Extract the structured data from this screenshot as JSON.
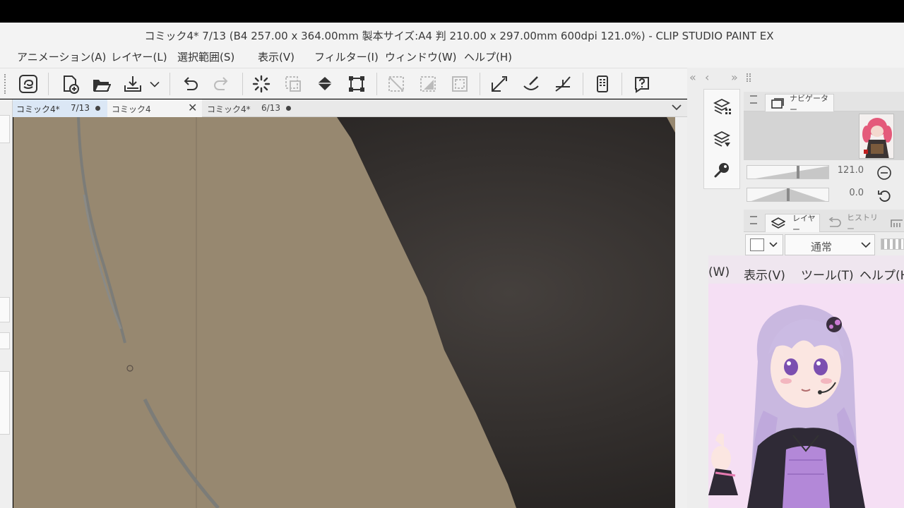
{
  "window": {
    "title": "コミック4* 7/13 (B4 257.00 x 364.00mm 製本サイズ:A4 判 210.00 x 297.00mm 600dpi 121.0%)  - CLIP STUDIO PAINT EX"
  },
  "menu": {
    "items": [
      "アニメーション(A)",
      "レイヤー(L)",
      "選択範囲(S)",
      "表示(V)",
      "フィルター(I)",
      "ウィンドウ(W)",
      "ヘルプ(H)"
    ]
  },
  "toolbar": {
    "buttons": [
      "clip-studio-icon",
      "new-file-icon",
      "open-folder-icon",
      "save-icon",
      "save-dropdown-icon",
      "undo-icon",
      "redo-icon",
      "loading-icon",
      "deselect-icon",
      "fill-icon",
      "transform-icon",
      "clear-outside-icon",
      "fill-selection-icon",
      "invert-selection-icon",
      "ruler-icon",
      "snap-ruler-icon",
      "perspective-ruler-icon",
      "device-icon",
      "help-icon"
    ]
  },
  "tabs": [
    {
      "name": "コミック4*",
      "page": "7/13",
      "state": "modified"
    },
    {
      "name": "コミック4",
      "page": "",
      "state": "closable"
    },
    {
      "name": "コミック4*",
      "page": "6/13",
      "state": "modified"
    }
  ],
  "panels": {
    "collapse_left": "«",
    "prev": "‹",
    "expand_right": "»",
    "navigator_tab": "ナビゲーター",
    "zoom_value": "121.0",
    "rotate_value": "0.0",
    "layer_tab": "レイヤー",
    "history_tab": "ヒストリー",
    "blend_mode": "通常"
  },
  "overlay_window": {
    "menu": [
      "(W)",
      "表示(V)",
      "ツール(T)",
      "ヘルプ(H"
    ]
  },
  "colors": {
    "canvas_skin": "#978870",
    "canvas_dark": "#2c2928",
    "stroke_gray": "#8a8a86"
  }
}
